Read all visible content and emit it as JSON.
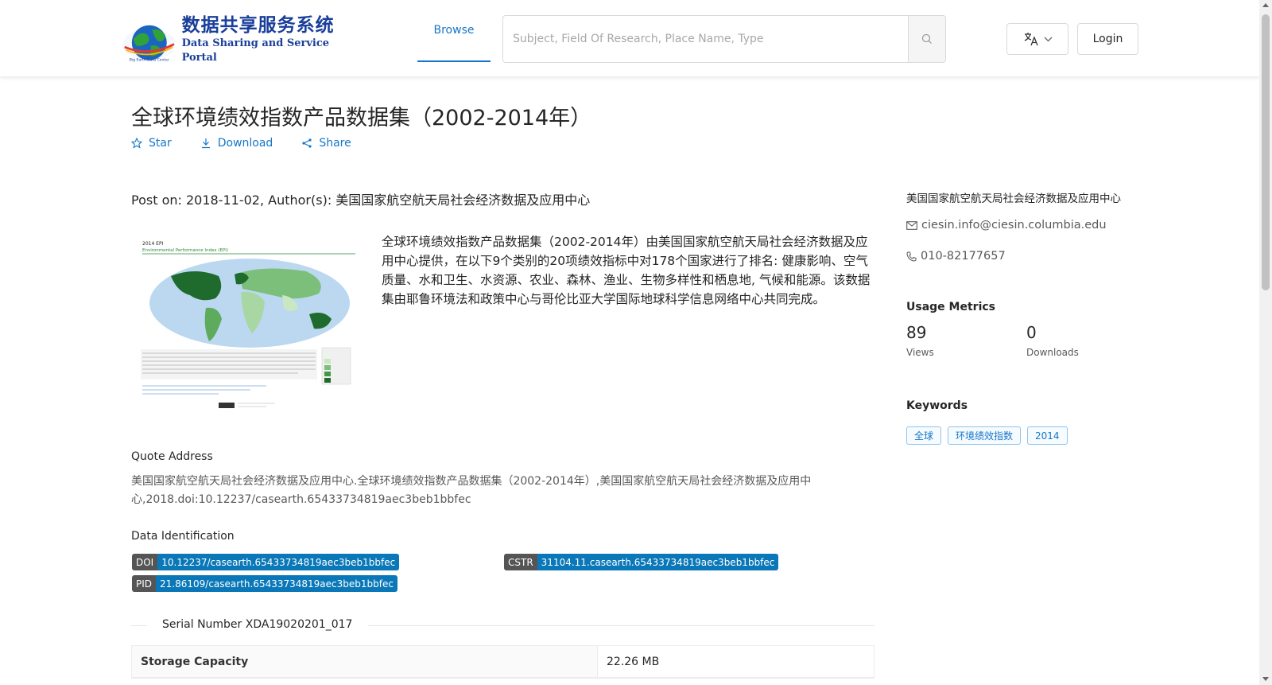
{
  "header": {
    "logo_cn": "数据共享服务系统",
    "logo_en": "Data Sharing and Service Portal",
    "nav_browse": "Browse",
    "search_placeholder": "Subject, Field Of Research, Place Name, Type",
    "login": "Login"
  },
  "dataset": {
    "title": "全球环境绩效指数产品数据集（2002-2014年）",
    "actions": {
      "star": "Star",
      "download": "Download",
      "share": "Share"
    },
    "post_on": "Post on: 2018-11-02, Author(s): 美国国家航空航天局社会经济数据及应用中心",
    "description": "全球环境绩效指数产品数据集（2002-2014年）由美国国家航空航天局社会经济数据及应用中心提供，在以下9个类别的20项绩效指标中对178个国家进行了排名: 健康影响、空气质量、水和卫生、水资源、农业、森林、渔业、生物多样性和栖息地, 气候和能源。该数据集由耶鲁环境法和政策中心与哥伦比亚大学国际地球科学信息网络中心共同完成。",
    "quote_heading": "Quote Address",
    "quote_text": "美国国家航空航天局社会经济数据及应用中心.全球环境绩效指数产品数据集（2002-2014年）,美国国家航空航天局社会经济数据及应用中心,2018.doi:10.12237/casearth.65433734819aec3beb1bbfec",
    "ident_heading": "Data Identification",
    "doi_key": "DOI",
    "doi_value": "10.12237/casearth.65433734819aec3beb1bbfec",
    "cstr_key": "CSTR",
    "cstr_value": "31104.11.casearth.65433734819aec3beb1bbfec",
    "pid_key": "PID",
    "pid_value": "21.86109/casearth.65433734819aec3beb1bbfec",
    "serial": "Serial Number XDA19020201_017",
    "table": [
      {
        "key": "Storage Capacity",
        "value": "22.26 MB"
      }
    ]
  },
  "sidebar": {
    "org": "美国国家航空航天局社会经济数据及应用中心",
    "email": "ciesin.info@ciesin.columbia.edu",
    "phone": "010-82177657",
    "metrics_heading": "Usage Metrics",
    "views_count": "89",
    "views_label": "Views",
    "downloads_count": "0",
    "downloads_label": "Downloads",
    "keywords_heading": "Keywords",
    "keywords": [
      "全球",
      "环境绩效指数",
      "2014"
    ]
  },
  "thumbnail": {
    "heading": "2014 EPI",
    "subheading": "Environmental Performance Index (EPI)"
  },
  "colors": {
    "link": "#1677c8",
    "badge_value": "#0a78b8",
    "badge_key": "#555555"
  }
}
